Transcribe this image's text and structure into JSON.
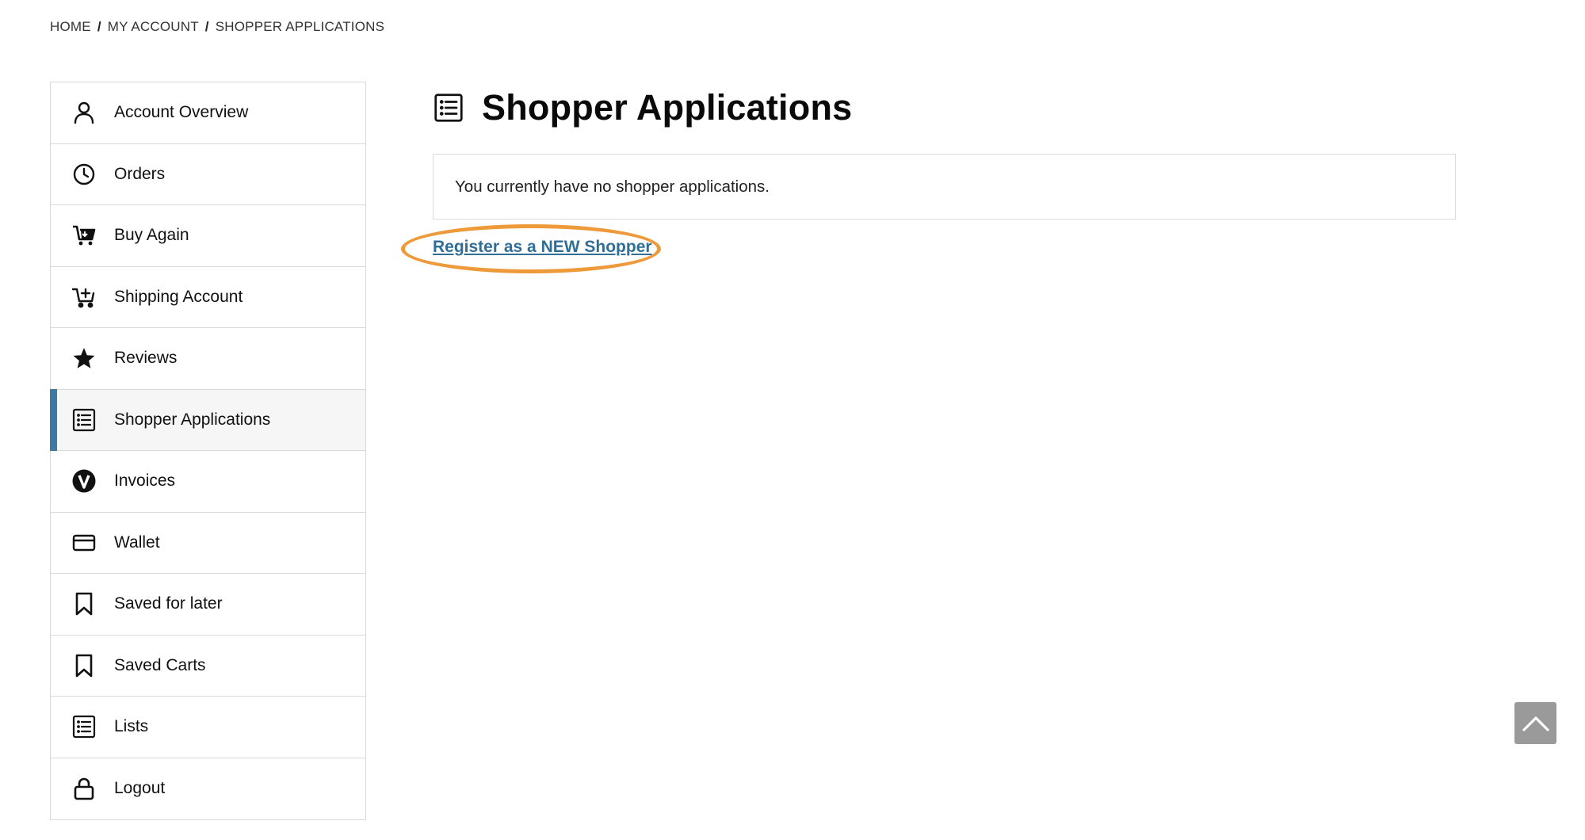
{
  "breadcrumb": {
    "home": "HOME",
    "account": "MY ACCOUNT",
    "current": "SHOPPER APPLICATIONS",
    "separator": "/"
  },
  "sidebar": {
    "items": [
      {
        "label": "Account Overview",
        "icon": "person-icon"
      },
      {
        "label": "Orders",
        "icon": "clock-icon"
      },
      {
        "label": "Buy Again",
        "icon": "cart-reorder-icon"
      },
      {
        "label": "Shipping Account",
        "icon": "cart-plus-icon"
      },
      {
        "label": "Reviews",
        "icon": "star-icon"
      },
      {
        "label": "Shopper Applications",
        "icon": "list-icon",
        "active": true
      },
      {
        "label": "Invoices",
        "icon": "v-circle-icon"
      },
      {
        "label": "Wallet",
        "icon": "credit-card-icon"
      },
      {
        "label": "Saved for later",
        "icon": "bookmark-icon"
      },
      {
        "label": "Saved Carts",
        "icon": "bookmark-icon"
      },
      {
        "label": "Lists",
        "icon": "list-icon"
      },
      {
        "label": "Logout",
        "icon": "lock-icon"
      }
    ]
  },
  "main": {
    "title": "Shopper Applications",
    "title_icon": "list-icon",
    "empty_message": "You currently have no shopper applications.",
    "register_link": "Register as a NEW Shopper"
  },
  "colors": {
    "accent": "#3a7aa5",
    "link": "#2f6e96",
    "highlight": "#ef9a3a",
    "back_to_top_bg": "#9a9a9a"
  },
  "back_to_top": {
    "icon": "chevron-up-icon"
  }
}
